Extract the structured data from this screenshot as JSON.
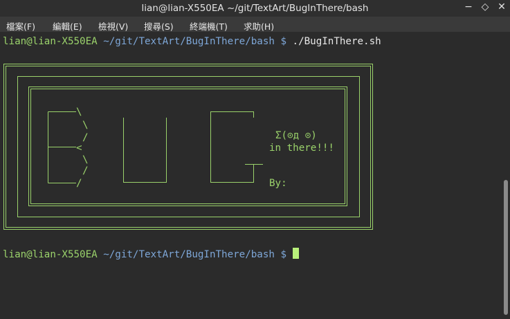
{
  "window": {
    "title": "lian@lian-X550EA ~/git/TextArt/BugInThere/bash",
    "controls": [
      "−",
      "◇",
      "✕"
    ]
  },
  "menu": [
    "檔案(F)",
    "編輯(E)",
    "檢視(V)",
    "搜尋(S)",
    "終端機(T)",
    "求助(H)"
  ],
  "terminal": {
    "line1": {
      "user": "lian@lian-X550EA",
      "path": " ~/git/TextArt/BugInThere/bash $ ",
      "command": "./BugInThere.sh"
    },
    "art": {
      "bug_chars": [
        "\\",
        "\\",
        "/",
        "<",
        "\\",
        "/",
        "/"
      ],
      "face": "Σ(⊙д ⊙)",
      "caption": "in there!!!",
      "by": "By:"
    },
    "line2": {
      "user": "lian@lian-X550EA",
      "path": " ~/git/TextArt/BugInThere/bash $ "
    }
  },
  "colors": {
    "prompt_user": "#9bd36b",
    "prompt_path": "#7ea7d8",
    "art": "#9bd36b",
    "background": "#2b2b2b"
  }
}
